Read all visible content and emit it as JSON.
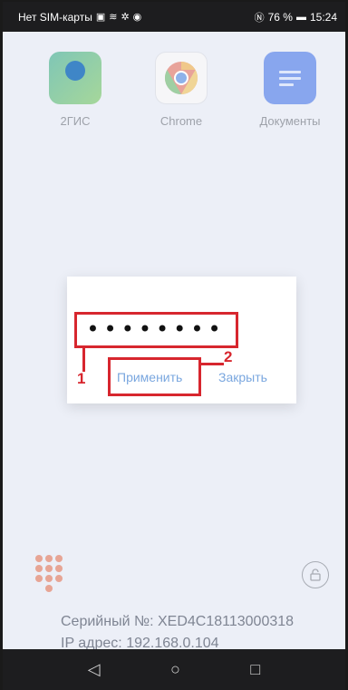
{
  "status": {
    "carrier": "Нет SIM-карты",
    "battery": "76 %",
    "time": "15:24"
  },
  "apps": [
    {
      "label": "2ГИС"
    },
    {
      "label": "Chrome"
    },
    {
      "label": "Документы"
    }
  ],
  "dialog": {
    "password_mask": "••••••••",
    "apply_label": "Применить",
    "close_label": "Закрыть"
  },
  "annotations": {
    "marker1": "1",
    "marker2": "2"
  },
  "info": {
    "serial": "Серийный №: XED4C18113000318",
    "ip": "IP адрес: 192.168.0.104"
  },
  "nav": {
    "back": "◁",
    "home": "○",
    "recents": "□"
  }
}
